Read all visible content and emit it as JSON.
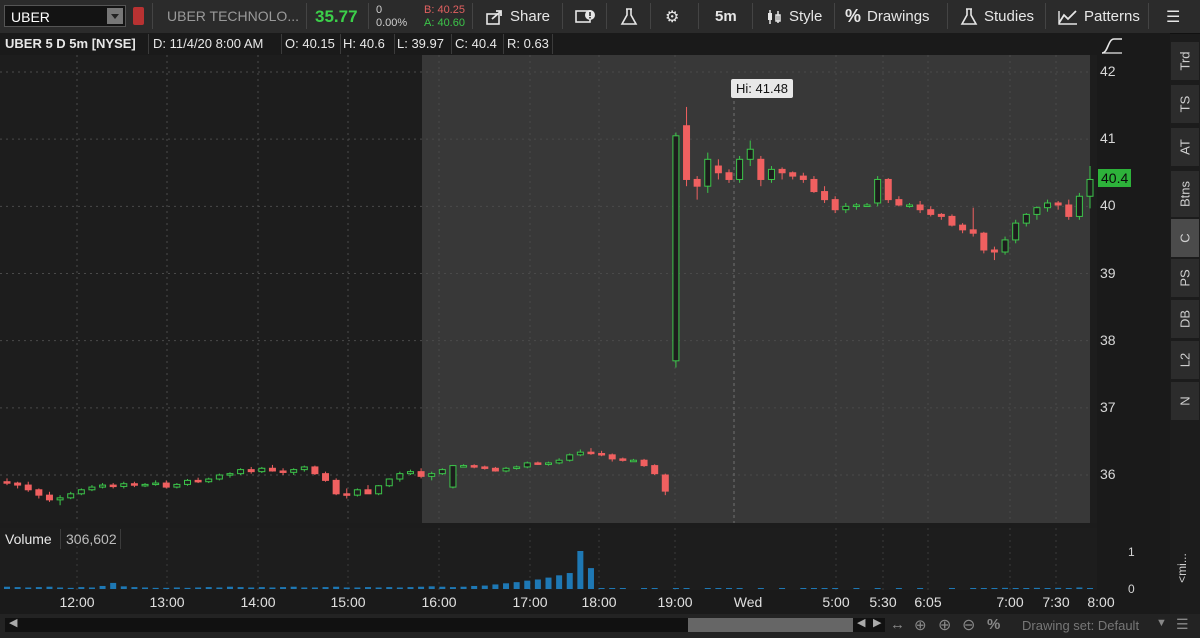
{
  "toolbar": {
    "symbol": "UBER",
    "company": "UBER TECHNOLO...",
    "last": "35.77",
    "change": "0",
    "change_pct": "0.00%",
    "bid": "B: 40.25",
    "ask": "A: 40.60",
    "share": "Share",
    "timeframe": "5m",
    "style": "Style",
    "drawings": "Drawings",
    "studies": "Studies",
    "patterns": "Patterns"
  },
  "info": {
    "title": "UBER 5 D 5m [NYSE]",
    "date": "D: 11/4/20 8:00 AM",
    "open": "O: 40.15",
    "high": "H: 40.6",
    "low": "L: 39.97",
    "close": "C: 40.4",
    "range": "R: 0.63"
  },
  "price_axis": [
    "42",
    "41",
    "40",
    "39",
    "38",
    "37",
    "36"
  ],
  "last_price_label": "40.4",
  "hi_label": "Hi: 41.48",
  "volume": {
    "label": "Volume",
    "value": "306,602",
    "axis_top": "1",
    "axis_bottom": "0"
  },
  "time_axis": [
    "12:00",
    "13:00",
    "14:00",
    "15:00",
    "16:00",
    "17:00",
    "18:00",
    "19:00",
    "Wed",
    "5:00",
    "5:30",
    "6:05",
    "7:00",
    "7:30",
    "8:00"
  ],
  "side_tabs": [
    "Trd",
    "TS",
    "AT",
    "Btns",
    "C",
    "PS",
    "DB",
    "L2",
    "N"
  ],
  "collapsed_panel": "<mi...",
  "drawing_set": "Drawing set: Default",
  "colors": {
    "up": "#3cc54a",
    "down": "#f06060",
    "volume": "#1e78b4",
    "accent": "#3cd04a"
  },
  "chart_data": {
    "type": "candlestick",
    "ylim": [
      35.3,
      42.3
    ],
    "candles": [
      {
        "o": 35.9,
        "h": 35.95,
        "l": 35.85,
        "c": 35.88
      },
      {
        "o": 35.88,
        "h": 35.9,
        "l": 35.8,
        "c": 35.85
      },
      {
        "o": 35.85,
        "h": 35.9,
        "l": 35.75,
        "c": 35.78
      },
      {
        "o": 35.78,
        "h": 35.8,
        "l": 35.65,
        "c": 35.7
      },
      {
        "o": 35.7,
        "h": 35.75,
        "l": 35.6,
        "c": 35.63
      },
      {
        "o": 35.63,
        "h": 35.7,
        "l": 35.55,
        "c": 35.66
      },
      {
        "o": 35.66,
        "h": 35.75,
        "l": 35.64,
        "c": 35.72
      },
      {
        "o": 35.72,
        "h": 35.8,
        "l": 35.7,
        "c": 35.78
      },
      {
        "o": 35.78,
        "h": 35.85,
        "l": 35.76,
        "c": 35.82
      },
      {
        "o": 35.82,
        "h": 35.88,
        "l": 35.8,
        "c": 35.85
      },
      {
        "o": 35.85,
        "h": 35.88,
        "l": 35.8,
        "c": 35.83
      },
      {
        "o": 35.83,
        "h": 35.9,
        "l": 35.8,
        "c": 35.87
      },
      {
        "o": 35.87,
        "h": 35.9,
        "l": 35.82,
        "c": 35.85
      },
      {
        "o": 35.85,
        "h": 35.88,
        "l": 35.82,
        "c": 35.86
      },
      {
        "o": 35.86,
        "h": 35.92,
        "l": 35.84,
        "c": 35.88
      },
      {
        "o": 35.88,
        "h": 35.92,
        "l": 35.8,
        "c": 35.82
      },
      {
        "o": 35.82,
        "h": 35.88,
        "l": 35.8,
        "c": 35.86
      },
      {
        "o": 35.86,
        "h": 35.94,
        "l": 35.84,
        "c": 35.92
      },
      {
        "o": 35.92,
        "h": 35.96,
        "l": 35.88,
        "c": 35.9
      },
      {
        "o": 35.9,
        "h": 35.96,
        "l": 35.88,
        "c": 35.94
      },
      {
        "o": 35.94,
        "h": 36.02,
        "l": 35.92,
        "c": 36.0
      },
      {
        "o": 36.0,
        "h": 36.04,
        "l": 35.96,
        "c": 36.02
      },
      {
        "o": 36.02,
        "h": 36.1,
        "l": 36.0,
        "c": 36.08
      },
      {
        "o": 36.08,
        "h": 36.12,
        "l": 36.02,
        "c": 36.05
      },
      {
        "o": 36.05,
        "h": 36.12,
        "l": 36.03,
        "c": 36.1
      },
      {
        "o": 36.1,
        "h": 36.15,
        "l": 36.05,
        "c": 36.06
      },
      {
        "o": 36.06,
        "h": 36.1,
        "l": 36.0,
        "c": 36.04
      },
      {
        "o": 36.04,
        "h": 36.1,
        "l": 36.0,
        "c": 36.08
      },
      {
        "o": 36.08,
        "h": 36.14,
        "l": 36.05,
        "c": 36.12
      },
      {
        "o": 36.12,
        "h": 36.14,
        "l": 36.0,
        "c": 36.02
      },
      {
        "o": 36.02,
        "h": 36.05,
        "l": 35.9,
        "c": 35.92
      },
      {
        "o": 35.92,
        "h": 35.95,
        "l": 35.7,
        "c": 35.72
      },
      {
        "o": 35.72,
        "h": 35.8,
        "l": 35.65,
        "c": 35.7
      },
      {
        "o": 35.7,
        "h": 35.8,
        "l": 35.68,
        "c": 35.78
      },
      {
        "o": 35.78,
        "h": 35.85,
        "l": 35.75,
        "c": 35.72
      },
      {
        "o": 35.72,
        "h": 35.85,
        "l": 35.7,
        "c": 35.84
      },
      {
        "o": 35.84,
        "h": 35.95,
        "l": 35.82,
        "c": 35.94
      },
      {
        "o": 35.94,
        "h": 36.05,
        "l": 35.9,
        "c": 36.02
      },
      {
        "o": 36.02,
        "h": 36.08,
        "l": 36.0,
        "c": 36.05
      },
      {
        "o": 36.05,
        "h": 36.1,
        "l": 35.95,
        "c": 35.98
      },
      {
        "o": 35.98,
        "h": 36.05,
        "l": 35.92,
        "c": 36.02
      },
      {
        "o": 36.02,
        "h": 36.1,
        "l": 36.0,
        "c": 36.08
      },
      {
        "o": 35.82,
        "h": 36.15,
        "l": 35.8,
        "c": 36.14
      },
      {
        "o": 36.14,
        "h": 36.16,
        "l": 36.12,
        "c": 36.14
      },
      {
        "o": 36.14,
        "h": 36.16,
        "l": 36.1,
        "c": 36.12
      },
      {
        "o": 36.12,
        "h": 36.14,
        "l": 36.08,
        "c": 36.1
      },
      {
        "o": 36.1,
        "h": 36.12,
        "l": 36.05,
        "c": 36.06
      },
      {
        "o": 36.06,
        "h": 36.12,
        "l": 36.04,
        "c": 36.1
      },
      {
        "o": 36.1,
        "h": 36.14,
        "l": 36.08,
        "c": 36.12
      },
      {
        "o": 36.12,
        "h": 36.2,
        "l": 36.1,
        "c": 36.18
      },
      {
        "o": 36.18,
        "h": 36.2,
        "l": 36.15,
        "c": 36.16
      },
      {
        "o": 36.16,
        "h": 36.2,
        "l": 36.14,
        "c": 36.18
      },
      {
        "o": 36.18,
        "h": 36.25,
        "l": 36.16,
        "c": 36.22
      },
      {
        "o": 36.22,
        "h": 36.32,
        "l": 36.2,
        "c": 36.3
      },
      {
        "o": 36.3,
        "h": 36.38,
        "l": 36.28,
        "c": 36.34
      },
      {
        "o": 36.34,
        "h": 36.4,
        "l": 36.3,
        "c": 36.32
      },
      {
        "o": 36.32,
        "h": 36.36,
        "l": 36.28,
        "c": 36.3
      },
      {
        "o": 36.3,
        "h": 36.32,
        "l": 36.2,
        "c": 36.24
      },
      {
        "o": 36.24,
        "h": 36.26,
        "l": 36.2,
        "c": 36.22
      },
      {
        "o": 36.22,
        "h": 36.24,
        "l": 36.2,
        "c": 36.22
      },
      {
        "o": 36.22,
        "h": 36.24,
        "l": 36.12,
        "c": 36.14
      },
      {
        "o": 36.14,
        "h": 36.16,
        "l": 36.0,
        "c": 36.02
      },
      {
        "o": 36.0,
        "h": 36.02,
        "l": 35.7,
        "c": 35.76
      },
      {
        "o": 37.7,
        "h": 41.1,
        "l": 37.6,
        "c": 41.05
      },
      {
        "o": 41.2,
        "h": 41.48,
        "l": 40.3,
        "c": 40.4
      },
      {
        "o": 40.4,
        "h": 40.45,
        "l": 40.1,
        "c": 40.3
      },
      {
        "o": 40.3,
        "h": 40.8,
        "l": 40.2,
        "c": 40.7
      },
      {
        "o": 40.6,
        "h": 40.7,
        "l": 40.4,
        "c": 40.5
      },
      {
        "o": 40.5,
        "h": 40.55,
        "l": 40.35,
        "c": 40.4
      },
      {
        "o": 40.4,
        "h": 40.75,
        "l": 40.35,
        "c": 40.7
      },
      {
        "o": 40.7,
        "h": 40.98,
        "l": 40.6,
        "c": 40.85
      },
      {
        "o": 40.7,
        "h": 40.75,
        "l": 40.3,
        "c": 40.4
      },
      {
        "o": 40.4,
        "h": 40.6,
        "l": 40.35,
        "c": 40.55
      },
      {
        "o": 40.55,
        "h": 40.58,
        "l": 40.4,
        "c": 40.5
      },
      {
        "o": 40.5,
        "h": 40.52,
        "l": 40.4,
        "c": 40.45
      },
      {
        "o": 40.45,
        "h": 40.5,
        "l": 40.35,
        "c": 40.4
      },
      {
        "o": 40.4,
        "h": 40.45,
        "l": 40.2,
        "c": 40.22
      },
      {
        "o": 40.22,
        "h": 40.3,
        "l": 40.05,
        "c": 40.1
      },
      {
        "o": 40.1,
        "h": 40.15,
        "l": 39.9,
        "c": 39.95
      },
      {
        "o": 39.95,
        "h": 40.05,
        "l": 39.9,
        "c": 40.0
      },
      {
        "o": 40.0,
        "h": 40.05,
        "l": 39.95,
        "c": 40.02
      },
      {
        "o": 40.02,
        "h": 40.05,
        "l": 40.0,
        "c": 40.02
      },
      {
        "o": 40.05,
        "h": 40.45,
        "l": 40.0,
        "c": 40.4
      },
      {
        "o": 40.4,
        "h": 40.42,
        "l": 40.05,
        "c": 40.1
      },
      {
        "o": 40.1,
        "h": 40.15,
        "l": 40.0,
        "c": 40.02
      },
      {
        "o": 40.02,
        "h": 40.05,
        "l": 39.98,
        "c": 40.02
      },
      {
        "o": 40.02,
        "h": 40.08,
        "l": 39.9,
        "c": 39.95
      },
      {
        "o": 39.95,
        "h": 40.0,
        "l": 39.85,
        "c": 39.88
      },
      {
        "o": 39.88,
        "h": 39.9,
        "l": 39.8,
        "c": 39.85
      },
      {
        "o": 39.85,
        "h": 39.88,
        "l": 39.7,
        "c": 39.72
      },
      {
        "o": 39.72,
        "h": 39.75,
        "l": 39.6,
        "c": 39.65
      },
      {
        "o": 39.65,
        "h": 39.98,
        "l": 39.55,
        "c": 39.6
      },
      {
        "o": 39.6,
        "h": 39.62,
        "l": 39.3,
        "c": 39.35
      },
      {
        "o": 39.35,
        "h": 39.4,
        "l": 39.2,
        "c": 39.32
      },
      {
        "o": 39.32,
        "h": 39.55,
        "l": 39.28,
        "c": 39.5
      },
      {
        "o": 39.5,
        "h": 39.8,
        "l": 39.45,
        "c": 39.75
      },
      {
        "o": 39.75,
        "h": 39.9,
        "l": 39.7,
        "c": 39.88
      },
      {
        "o": 39.88,
        "h": 40.0,
        "l": 39.8,
        "c": 39.98
      },
      {
        "o": 39.98,
        "h": 40.1,
        "l": 39.92,
        "c": 40.05
      },
      {
        "o": 40.05,
        "h": 40.08,
        "l": 39.95,
        "c": 40.02
      },
      {
        "o": 40.02,
        "h": 40.1,
        "l": 39.8,
        "c": 39.85
      },
      {
        "o": 39.85,
        "h": 40.2,
        "l": 39.8,
        "c": 40.15
      },
      {
        "o": 40.15,
        "h": 40.6,
        "l": 39.97,
        "c": 40.4
      }
    ],
    "volume": [
      0.06,
      0.05,
      0.04,
      0.05,
      0.06,
      0.04,
      0.03,
      0.05,
      0.04,
      0.08,
      0.16,
      0.07,
      0.05,
      0.04,
      0.03,
      0.03,
      0.04,
      0.03,
      0.04,
      0.05,
      0.04,
      0.06,
      0.05,
      0.04,
      0.05,
      0.04,
      0.05,
      0.06,
      0.04,
      0.04,
      0.05,
      0.06,
      0.04,
      0.04,
      0.05,
      0.04,
      0.05,
      0.04,
      0.05,
      0.06,
      0.07,
      0.06,
      0.05,
      0.06,
      0.08,
      0.09,
      0.12,
      0.15,
      0.18,
      0.22,
      0.25,
      0.3,
      0.36,
      0.42,
      1.0,
      0.55,
      0.02,
      0.01,
      0.01,
      0.0,
      0.02,
      0.01,
      0.0,
      0.01,
      0.01,
      0.0,
      0.01,
      0.02,
      0.01,
      0.01,
      0.0,
      0.01,
      0.0,
      0.01,
      0.0,
      0.01,
      0.01,
      0.02,
      0.01,
      0.0,
      0.01,
      0.0,
      0.01,
      0.0,
      0.01,
      0.0,
      0.01,
      0.0,
      0.0,
      0.01,
      0.0,
      0.01,
      0.01,
      0.02,
      0.03,
      0.02,
      0.02,
      0.03,
      0.02,
      0.03,
      0.02,
      0.04,
      0.02,
      0.03,
      0.04,
      0.1,
      0.18
    ]
  }
}
